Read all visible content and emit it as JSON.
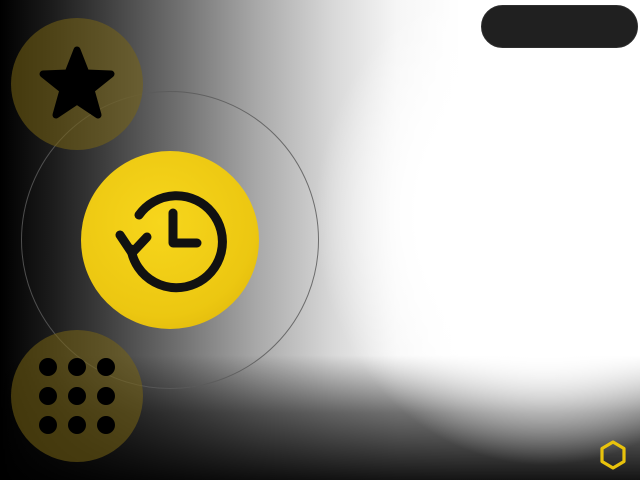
{
  "window": {
    "title": ""
  },
  "top_pill": {
    "label": ""
  },
  "buttons": {
    "favorites": {
      "icon": "star-icon"
    },
    "history": {
      "icon": "history-icon"
    },
    "apps": {
      "icon": "grid-dots-icon"
    }
  },
  "corner": {
    "icon": "hexagon-icon"
  },
  "colors": {
    "accent": "#ecc711",
    "accent_dim": "#786414",
    "pill": "#202020",
    "icon": "#000000"
  }
}
